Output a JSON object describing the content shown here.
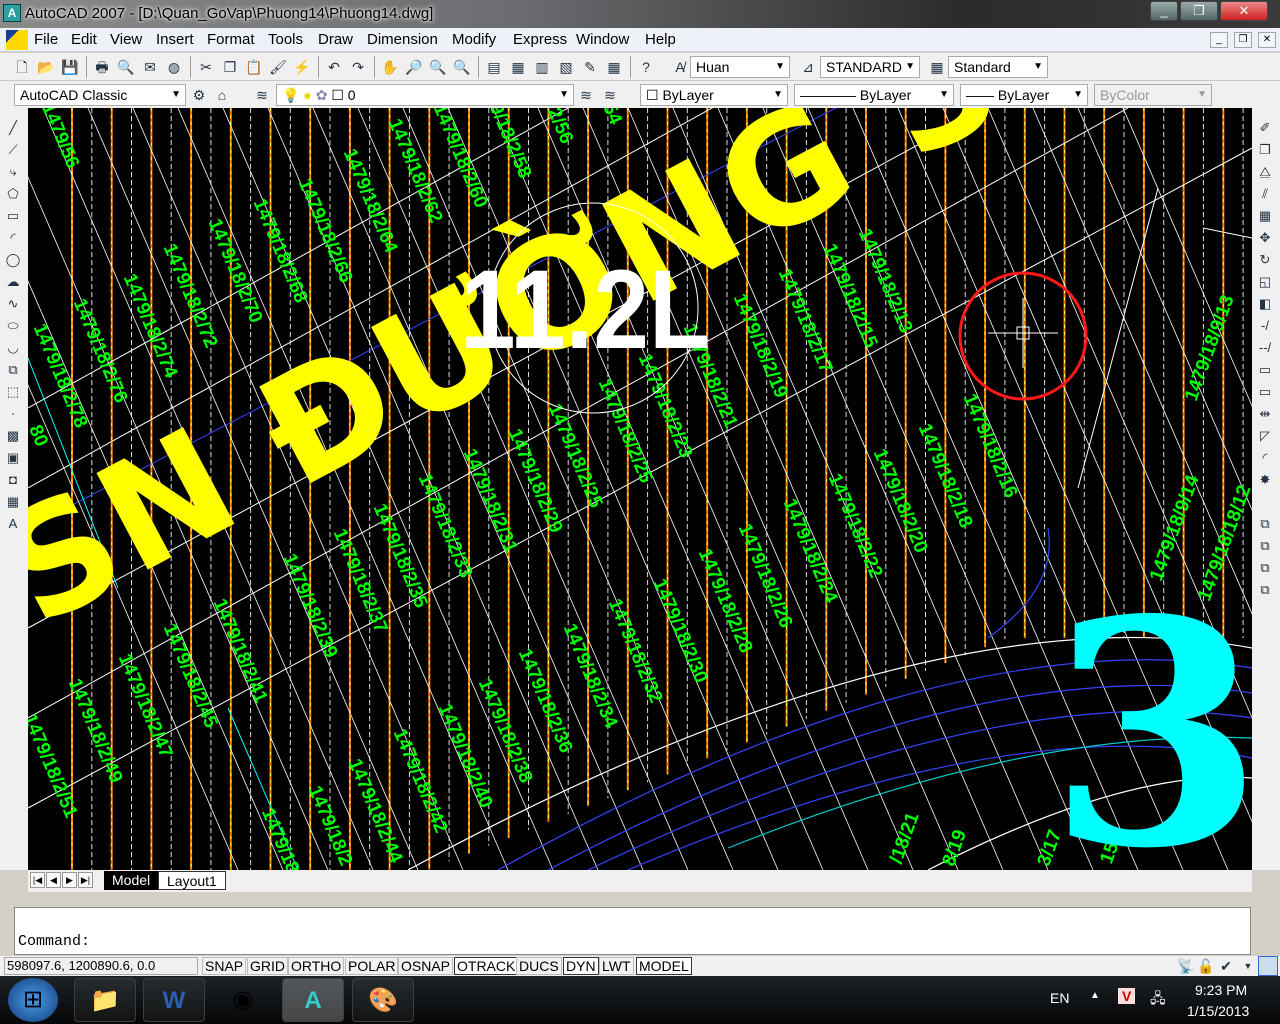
{
  "window": {
    "title": "AutoCAD 2007 - [D:\\Quan_GoVap\\Phuong14\\Phuong14.dwg]",
    "controls": [
      "minimize",
      "maximize",
      "close"
    ]
  },
  "menu": [
    "File",
    "Edit",
    "View",
    "Insert",
    "Format",
    "Tools",
    "Draw",
    "Dimension",
    "Modify",
    "Express",
    "Window",
    "Help"
  ],
  "styles_toolbar": {
    "text_style": "Huan",
    "dim_style": "STANDARD",
    "table_style": "Standard"
  },
  "workspace": {
    "name": "AutoCAD Classic"
  },
  "layers": {
    "current": "0"
  },
  "properties": {
    "color": "ByLayer",
    "linetype": "ByLayer",
    "lineweight": "ByLayer",
    "plotstyle": "ByColor"
  },
  "drawing": {
    "street_label": "SN ĐƯỜNG SỐ",
    "area_label": "11.2L",
    "block_number": "3",
    "lot_labels_down": [
      "1479/56",
      "1479/18/2/62",
      "1479/18/2/60",
      "9/18/2/58",
      "2/56",
      "54",
      "1479/18/2/64",
      "1479/18/2/66",
      "1479/18/2/68",
      "1479/18/2/70",
      "1479/18/2/72",
      "1479/18/2/74",
      "1479/18/2/76",
      "1479/18/2/78",
      "1479/18/2/13",
      "1479/18/2/15",
      "1479/18/2/17",
      "1479/18/2/19",
      "1479/18/2/21",
      "1479/18/2/23",
      "1479/18/2/25",
      "1479/18/2/25",
      "1479/18/2/29",
      "1479/18/2/31",
      "1479/18/2/33",
      "1479/18/2/35",
      "1479/18/2/37",
      "1479/18/2/39",
      "1479/18/2/41",
      "1479/18/2/45",
      "1479/18/2/47",
      "1479/18/2/49",
      "1479/18/2/51",
      "1479/18/2/16",
      "1479/18/2/18",
      "1479/18/2/20",
      "1479/18/2/22",
      "1479/18/2/24",
      "1479/18/2/26",
      "1479/18/2/28",
      "1479/18/2/30",
      "1479/18/2/32",
      "1479/18/2/34",
      "1479/18/2/36",
      "1479/18/2/38",
      "1479/18/2/40",
      "1479/18/2/42",
      "1479/18/2/44",
      "1479/18/2",
      "1479/18",
      "80"
    ],
    "lot_labels_up": [
      "1479/18/9/13",
      "1479/18/9/14",
      "1479/18/18/12",
      "/18/21",
      "8/19",
      "3/17",
      "15"
    ],
    "colors": {
      "lot_text": "#00ff00",
      "street_text": "#ffff00",
      "block_number": "#00ffff",
      "selection_circle": "#ff0000",
      "grid_orange": "#ff7f00"
    }
  },
  "tabs": {
    "model": "Model",
    "layout1": "Layout1"
  },
  "command": {
    "prompt": "Command:"
  },
  "status": {
    "coordinates": "598097.6, 1200890.6, 0.0",
    "buttons": [
      {
        "label": "SNAP",
        "on": false
      },
      {
        "label": "GRID",
        "on": false
      },
      {
        "label": "ORTHO",
        "on": false
      },
      {
        "label": "POLAR",
        "on": false
      },
      {
        "label": "OSNAP",
        "on": false
      },
      {
        "label": "OTRACK",
        "on": true
      },
      {
        "label": "DUCS",
        "on": false
      },
      {
        "label": "DYN",
        "on": true
      },
      {
        "label": "LWT",
        "on": false
      },
      {
        "label": "MODEL",
        "on": true
      }
    ]
  },
  "taskbar": {
    "apps": [
      "windows-start",
      "file-explorer",
      "microsoft-word",
      "google-chrome",
      "autocad",
      "paint"
    ],
    "language": "EN",
    "time": "9:23 PM",
    "date": "1/15/2013"
  }
}
